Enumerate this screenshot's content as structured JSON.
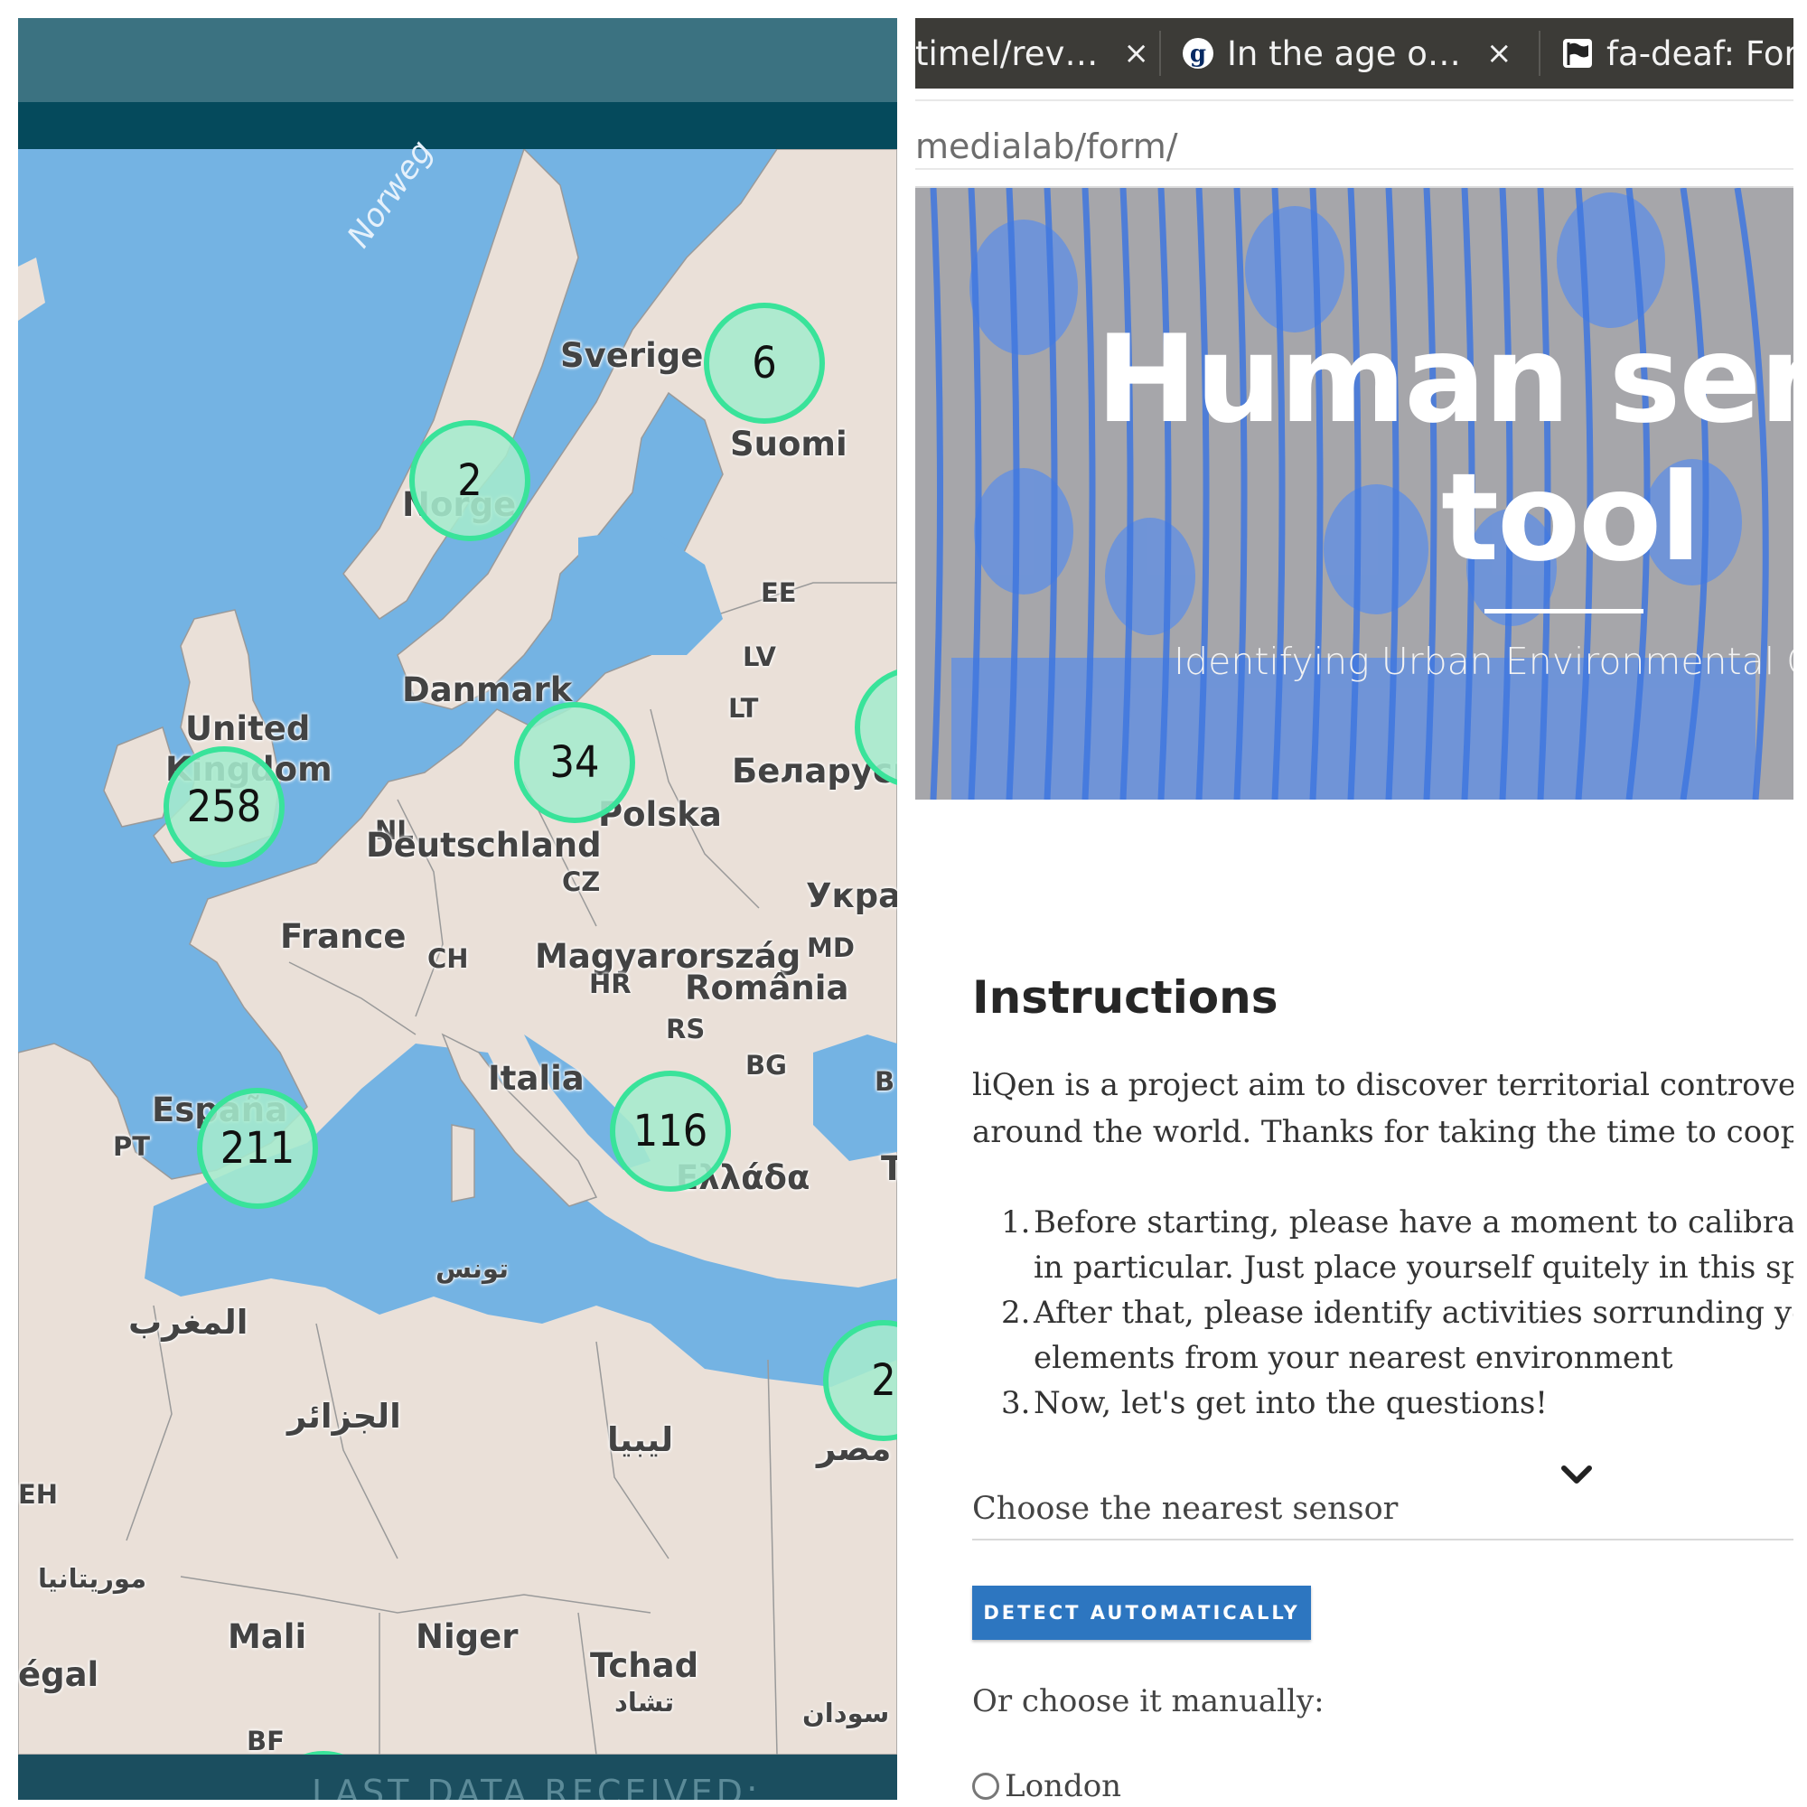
{
  "map_panel": {
    "countries": [
      {
        "id": "sverige",
        "label": "Sverige"
      },
      {
        "id": "suomi",
        "label": "Suomi"
      },
      {
        "id": "norge",
        "label": "Norge"
      },
      {
        "id": "ee",
        "label": "EE"
      },
      {
        "id": "lv",
        "label": "LV"
      },
      {
        "id": "lt",
        "label": "LT"
      },
      {
        "id": "danmark",
        "label": "Danmark"
      },
      {
        "id": "uk1",
        "label": "United"
      },
      {
        "id": "uk2",
        "label": "Kingdom"
      },
      {
        "id": "belarus",
        "label": "Беларусь"
      },
      {
        "id": "nl",
        "label": "NL"
      },
      {
        "id": "polska",
        "label": "Polska"
      },
      {
        "id": "deutschland",
        "label": "Deutschland"
      },
      {
        "id": "cz",
        "label": "CZ"
      },
      {
        "id": "ukraina",
        "label": "Укра"
      },
      {
        "id": "france",
        "label": "France"
      },
      {
        "id": "ch",
        "label": "CH"
      },
      {
        "id": "magyar",
        "label": "Magyarország"
      },
      {
        "id": "md",
        "label": "MD"
      },
      {
        "id": "hr",
        "label": "HR"
      },
      {
        "id": "romania",
        "label": "România"
      },
      {
        "id": "rs",
        "label": "RS"
      },
      {
        "id": "italia",
        "label": "Italia"
      },
      {
        "id": "bg",
        "label": "BG"
      },
      {
        "id": "espana",
        "label": "España"
      },
      {
        "id": "pt",
        "label": "PT"
      },
      {
        "id": "ellada",
        "label": "Ελλάδα"
      },
      {
        "id": "tounes",
        "label": "تونس"
      },
      {
        "id": "maghreb",
        "label": "المغرب"
      },
      {
        "id": "jazair",
        "label": "الجزائر"
      },
      {
        "id": "libya",
        "label": "ليبيا"
      },
      {
        "id": "misr",
        "label": "مصر"
      },
      {
        "id": "eh",
        "label": "EH"
      },
      {
        "id": "mauritania",
        "label": "موريتانيا"
      },
      {
        "id": "mali",
        "label": "Mali"
      },
      {
        "id": "niger",
        "label": "Niger"
      },
      {
        "id": "tchad",
        "label": "Tchad"
      },
      {
        "id": "tchad_ar",
        "label": "تشاد"
      },
      {
        "id": "senegal",
        "label": "égal"
      },
      {
        "id": "sudan",
        "label": "سودان"
      },
      {
        "id": "bf",
        "label": "BF"
      },
      {
        "id": "t_cut",
        "label": "T"
      },
      {
        "id": "b_cut",
        "label": "B"
      }
    ],
    "sea_label": "Norweg",
    "clusters": [
      {
        "id": "c-finland",
        "count": "6"
      },
      {
        "id": "c-norway",
        "count": "2"
      },
      {
        "id": "c-denmark",
        "count": "34"
      },
      {
        "id": "c-uk",
        "count": "258"
      },
      {
        "id": "c-spain",
        "count": "211"
      },
      {
        "id": "c-greece",
        "count": "116"
      },
      {
        "id": "c-egypt",
        "count": "2"
      },
      {
        "id": "c-belarus",
        "count": ""
      },
      {
        "id": "c-bottom",
        "count": ""
      }
    ],
    "bottom_bar_text": "LAST DATA RECEIVED:",
    "colors": {
      "water": "#74b3e3",
      "land": "#eae0d8",
      "cluster_fill": "#a5ebcd",
      "cluster_border": "#39e39a",
      "topbar": "#3b7281",
      "subbar": "#054a5c"
    }
  },
  "browser": {
    "tabs": [
      {
        "label": "timel/rev…",
        "close": "×",
        "icon": "none"
      },
      {
        "label": "In the age o…",
        "close": "×",
        "icon": "guardian-g-icon"
      },
      {
        "label": "fa-deaf: For",
        "icon": "flag-icon"
      }
    ],
    "url": "medialab/form/",
    "hero": {
      "title_line1": "Human ser",
      "title_line2": "tool",
      "subtitle": "Identifying Urban Environmental Con"
    },
    "instructions": {
      "heading": "Instructions",
      "paragraph_lines": [
        "liQen is a project aim to discover territorial controversie",
        "around the world. Thanks for taking the time to coopera"
      ],
      "steps": [
        {
          "num": "1.",
          "lines": [
            "Before starting, please have a moment to calibrate y",
            "in particular. Just place yourself quitely in this spot f"
          ]
        },
        {
          "num": "2.",
          "lines": [
            "After that, please identify activities sorrunding you i",
            "elements from your nearest environment"
          ]
        },
        {
          "num": "3.",
          "lines": [
            "Now, let's get into the questions!"
          ]
        }
      ]
    },
    "sensor_select_label": "Choose the nearest sensor",
    "detect_button": "DETECT AUTOMATICALLY",
    "manual_label": "Or choose it manually:",
    "radio_option": "London",
    "colors": {
      "tabbar": "#3c3b37",
      "button": "#2d76c0",
      "hero_tint": "#4a80e0"
    }
  }
}
